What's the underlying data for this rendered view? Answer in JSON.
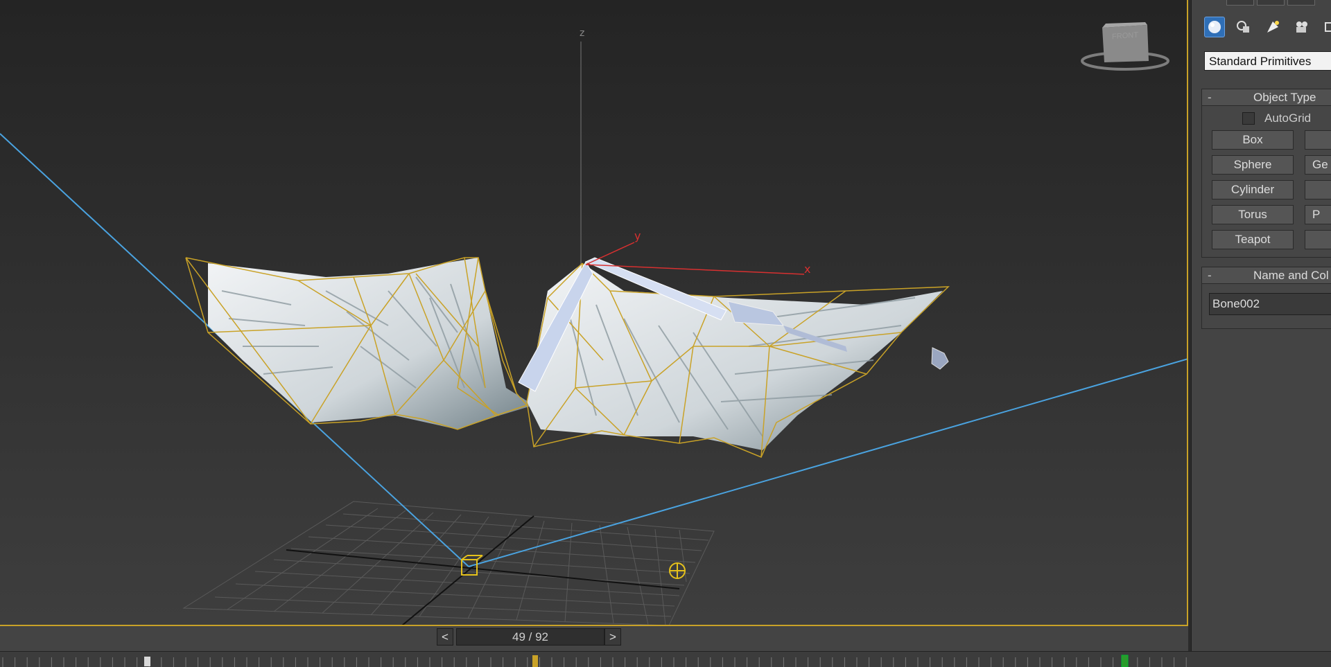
{
  "viewport": {
    "axis_z_label": "z",
    "gizmo_x_label": "x",
    "gizmo_y_label": "y",
    "viewcube_label": "FRONT"
  },
  "command_panel": {
    "categories": [
      {
        "icon": "geometry-sphere-icon",
        "active": true
      },
      {
        "icon": "shapes-icon",
        "active": false
      },
      {
        "icon": "lights-icon",
        "active": false
      },
      {
        "icon": "cameras-icon",
        "active": false
      },
      {
        "icon": "helpers-icon",
        "active": false
      }
    ],
    "primitive_type": "Standard Primitives",
    "object_type": {
      "title": "Object Type",
      "collapse_symbol": "-",
      "autogrid_label": "AutoGrid",
      "buttons_left": [
        "Box",
        "Sphere",
        "Cylinder",
        "Torus",
        "Teapot"
      ],
      "buttons_right": [
        "",
        "Ge",
        "",
        "P",
        ""
      ]
    },
    "name_and_color": {
      "title": "Name and Col",
      "collapse_symbol": "-",
      "name_value": "Bone002"
    }
  },
  "time_slider": {
    "label": "49 / 92",
    "prev": "<",
    "next": ">"
  },
  "colors": {
    "selection": "#c9a227",
    "bone_line": "#4aa3e0",
    "gizmo_x": "#d83030",
    "active_icon": "#2f6fb7"
  }
}
